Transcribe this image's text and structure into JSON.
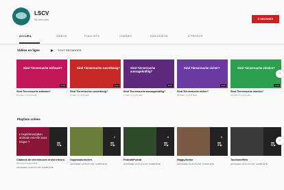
{
  "channel": {
    "name": "LSCV",
    "subscribers": "96 abonnés",
    "subscribe_label": "S'ABONNER",
    "accent": "#cc1f1f"
  },
  "tabs": [
    {
      "label": "ACCUEIL",
      "active": true
    },
    {
      "label": "VIDÉOS",
      "active": false
    },
    {
      "label": "PLAYLISTS",
      "active": false
    },
    {
      "label": "CHAÎNES",
      "active": false
    },
    {
      "label": "DISCUSSION",
      "active": false
    },
    {
      "label": "À PROPOS",
      "active": false
    }
  ],
  "icons": {
    "search": "search-icon",
    "tabs_next": "chevron-right-icon",
    "shelf_next": "chevron-right-icon"
  },
  "videos_section": {
    "title": "Vidéos en ligne",
    "play_all": "TOUT REGARDER",
    "items": [
      {
        "thumb_text": "Sind Tierversuche wirksam?",
        "color": "#c2185b",
        "duration": "0:24",
        "title": "Sind Tierversuche wirksam?",
        "meta": "12 vues • il y a 3 mois"
      },
      {
        "thumb_text": "Sind Tierversuche zuverlässig?",
        "color": "#c62828",
        "duration": "0:24",
        "title": "Sind Tierversuche zuverlässig?",
        "meta": "9 vues • il y a 3 mois"
      },
      {
        "thumb_text": "Sind Tierversuche aussagekräftig?",
        "color": "#5e2a7e",
        "duration": "0:24",
        "title": "Sind Tierversuche aussagekräftig?",
        "meta": "7 vues • il y a 3 mois"
      },
      {
        "thumb_text": "Sind Tierversuche sicher?",
        "color": "#6a3aa0",
        "duration": "0:24",
        "title": "Sind Tierversuche sicher?",
        "meta": "18 vues • il y a 3 mois"
      },
      {
        "thumb_text": "Sind Tierversuche sinnlos?",
        "color": "#2e9e4f",
        "duration": "0:24",
        "title": "Sind Tierversuche sinnlos?",
        "meta": "11 vues • il y a 3 mois"
      }
    ]
  },
  "playlists_section": {
    "title": "Playlists créées",
    "items": [
      {
        "overlay": "L'expérimentation animale est-elle sans risque ?",
        "count": "",
        "main_color": "#8a1538",
        "title": "Citations de chercheuses et chercheurs",
        "meta": "Mise à jour aujourd'hui",
        "link": "AFFICHER LA PLAYLIST COMPLÈTE"
      },
      {
        "overlay": "",
        "count": "2",
        "main_color": "#6b7d3a",
        "title": "Organisatorisches",
        "meta": "",
        "link": "AFFICHER LA PLAYLIST COMPLÈTE"
      },
      {
        "overlay": "",
        "count": "8",
        "main_color": "#2f4a2a",
        "title": "Portrait/Porträt",
        "meta": "",
        "link": "AFFICHER LA PLAYLIST COMPLÈTE"
      },
      {
        "overlay": "",
        "count": "5",
        "main_color": "#7a5a44",
        "title": "Happy Beehe",
        "meta": "",
        "link": "AFFICHER LA PLAYLIST COMPLÈTE"
      },
      {
        "overlay": "",
        "count": "",
        "main_color": "#3a3a3a",
        "title": "Tourisme/Reis",
        "meta": "",
        "link": "AFFICHER LA PLAYLIST COMPLÈTE"
      }
    ]
  }
}
